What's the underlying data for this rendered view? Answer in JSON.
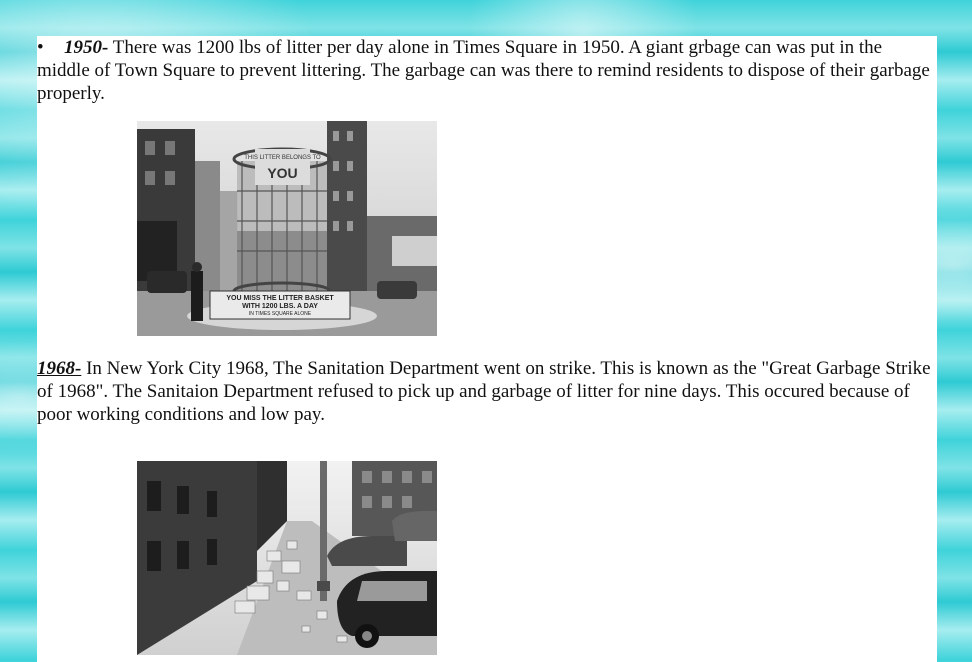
{
  "entries": [
    {
      "bullet": "•",
      "year": "1950-",
      "text": " There was 1200 lbs of litter per day alone in Times Square in 1950. A giant grbage can was put in the middle of Town Square to prevent littering. The garbage can was there to remind residents to dispose of their garbage properly.",
      "photo": {
        "sign_top": "THIS LITTER BELONGS TO",
        "sign_you": "YOU",
        "sign_bottom_1": "YOU MISS THE LITTER BASKET",
        "sign_bottom_2": "WITH 1200 LBS. A DAY",
        "sign_bottom_3": "IN TIMES SQUARE ALONE"
      }
    },
    {
      "year": "1968-",
      "text": " In New York City 1968, The Sanitation Department went on strike. This is known as the \"Great Garbage Strike of 1968\". The Sanitaion Department refused to pick up and garbage of litter for nine days. This occured because of poor working conditions and low pay."
    }
  ]
}
